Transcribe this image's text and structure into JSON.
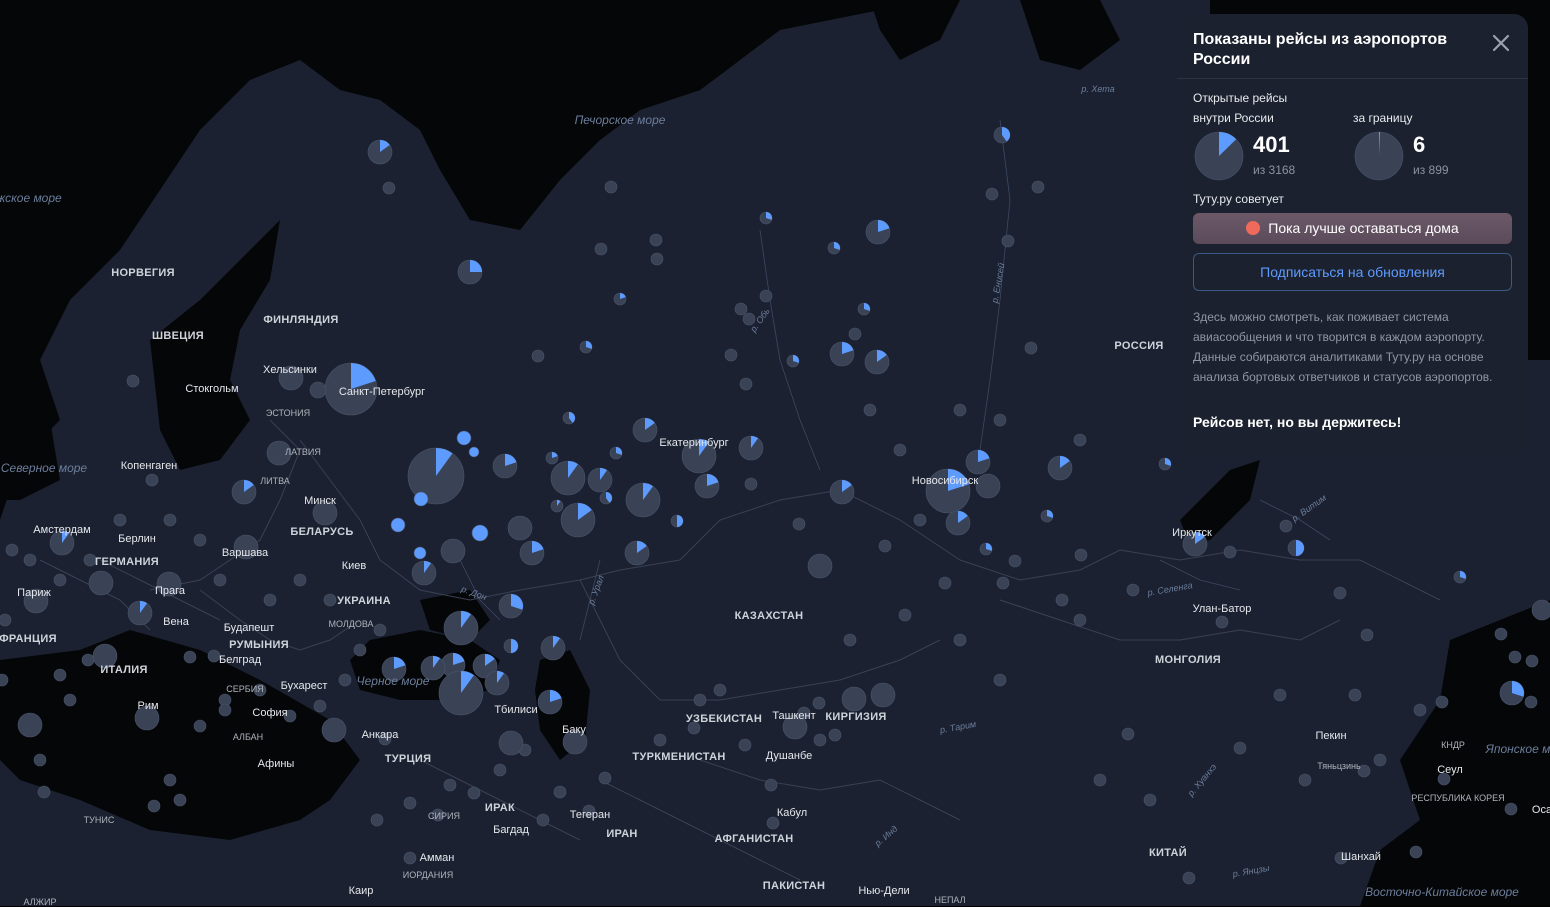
{
  "panel": {
    "title": "Показаны рейсы из аэропортов России",
    "domestic": {
      "caption_line1": "Открытые рейсы",
      "caption_line2": "внутри России",
      "count": "401",
      "of": "из 3168",
      "fraction": 0.127
    },
    "abroad": {
      "caption": "за границу",
      "count": "6",
      "of": "из 899",
      "fraction": 0.007
    },
    "advice_heading": "Туту.ру советует",
    "advice": "Пока лучше оставаться дома",
    "subscribe": "Подписаться на обновления",
    "description": "Здесь можно смотреть, как поживает система авиасообщения и что творится в каждом аэропорту. Данные собираются аналитиками Туту.ру на основе анализа бортовых ответчиков и статусов аэропортов.",
    "motto": "Рейсов нет, но вы держитесь!",
    "close_icon": "close-icon"
  },
  "colors": {
    "land": "#1b2130",
    "water": "#050608",
    "pie_bg": "#3a4356",
    "pie_fill": "#5e9bff",
    "panel": "#1b212e",
    "accent": "#5e9bff"
  },
  "labels": {
    "countries": [
      "НОРВЕГИЯ",
      "ШВЕЦИЯ",
      "ФИНЛЯНДИЯ",
      "ЭСТОНИЯ",
      "ЛАТВИЯ",
      "ЛИТВА",
      "БЕЛАРУСЬ",
      "ГЕРМАНИЯ",
      "УКРАИНА",
      "МОЛДОВА",
      "РУМЫНИЯ",
      "СЕРБИЯ",
      "АЛБАН",
      "ФРАНЦИЯ",
      "ИТАЛИЯ",
      "ТУРЦИЯ",
      "СИРИЯ",
      "ИРАК",
      "ИРАН",
      "ИОРДАНИЯ",
      "ТУНИС",
      "АЛЖИР",
      "КАЗАХСТАН",
      "УЗБЕКИСТАН",
      "ТУРКМЕНИСТАН",
      "КИРГИЗИЯ",
      "АФГАНИСТАН",
      "ПАКИСТАН",
      "НЕПАЛ",
      "МОНГОЛИЯ",
      "КИТАЙ",
      "РОССИЯ",
      "КНДР",
      "РЕСПУБЛИКА КОРЕЯ"
    ],
    "cities": [
      "Хельсинки",
      "Стокгольм",
      "Копенгаген",
      "Амстердам",
      "Берлин",
      "Париж",
      "Прага",
      "Вена",
      "Варшава",
      "Минск",
      "Киев",
      "Будапешт",
      "Белград",
      "Бухарест",
      "София",
      "Рим",
      "Афины",
      "Анкара",
      "Тбилиси",
      "Баку",
      "Тегеран",
      "Багдад",
      "Амман",
      "Каир",
      "Ташкент",
      "Душанбе",
      "Кабул",
      "Нью-Дели",
      "Санкт-Петербург",
      "Екатеринбург",
      "Новосибирск",
      "Иркутск",
      "Улан-Батор",
      "Пекин",
      "Тяньцзинь",
      "Сеул",
      "Шанхай",
      "Оса"
    ],
    "water": [
      "Печорское море",
      "Северное море",
      "Черное море",
      "Японское море",
      "Восточно-Китайское море",
      "Норвежское море"
    ],
    "rivers": [
      "р. Хета",
      "р. Обь",
      "р. Енисей",
      "р. Дон",
      "р. Урал",
      "р. Селенга",
      "р. Витим",
      "р. Тарим",
      "р. Инд",
      "р. Хуанхэ",
      "р. Янцзы"
    ]
  }
}
